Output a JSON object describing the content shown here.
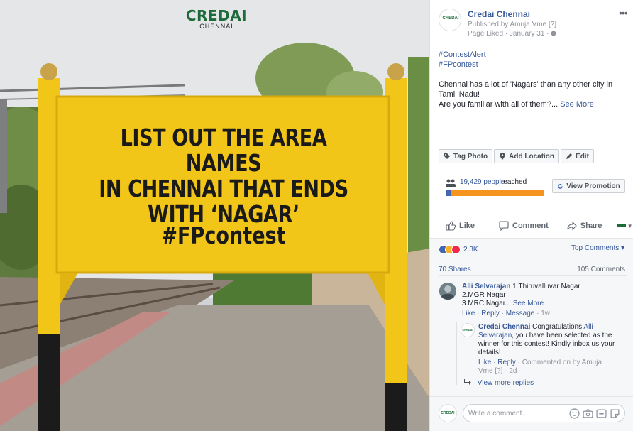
{
  "photo": {
    "brand_name": "CREDAI",
    "brand_sub": "CHENNAI",
    "headline_lines": [
      "LIST OUT THE AREA NAMES",
      "IN CHENNAI THAT ENDS",
      "WITH ‘NAGAR’"
    ],
    "hashtag": "#FPcontest"
  },
  "post": {
    "page_name": "Credai Chennai",
    "published_by": "Published by Amuja Vme",
    "published_q": "[?]",
    "page_liked": "Page Liked · January 31 ·",
    "menu": "•••",
    "hashtags": [
      "#ContestAlert",
      "#FPcontest"
    ],
    "body": "Chennai has a lot of 'Nagars' than any other city in Tamil Nadu!",
    "body_2": "Are you familiar with all of them?...",
    "see_more": "See More",
    "actions": {
      "tag_photo": "Tag Photo",
      "add_location": "Add Location",
      "edit": "Edit"
    },
    "reach": {
      "count": "19,429 people",
      "label": "reached",
      "button": "View Promotion",
      "organic_fraction": 0.06
    }
  },
  "bar": {
    "like": "Like",
    "comment": "Comment",
    "share": "Share"
  },
  "engagement": {
    "reactions_count": "2.3K",
    "top_comments": "Top Comments",
    "top_comments_caret": "▾",
    "shares": "70 Shares",
    "comments_count": "105 Comments"
  },
  "comments": [
    {
      "author": "Alli Selvarajan",
      "text_1": " 1.Thiruvalluvar Nagar",
      "text_2": "2.MGR Nagar",
      "text_3": "3.MRC Nagar...",
      "see_more": "See More",
      "like": "Like",
      "reply": "Reply",
      "message": "Message",
      "time": "1w"
    }
  ],
  "reply": {
    "author": "Credai Chennai",
    "text_a": " Congratulations ",
    "mention_1": "Alli",
    "mention_2": "Selvarajan",
    "text_b": ", you have been selected as the",
    "text_c": "winner for this contest! Kindly inbox us your",
    "text_d": "details!",
    "like": "Like",
    "reply": "Reply",
    "commented_on_by": "Commented on by Amuja",
    "vme": "Vme",
    "q": "[?]",
    "time": "2d"
  },
  "view_more_replies": "View more replies",
  "write_placeholder": "Write a comment...",
  "colors": {
    "fb_blue": "#365899",
    "reach_orange": "#f5951f",
    "board_yellow": "#f2c519"
  }
}
